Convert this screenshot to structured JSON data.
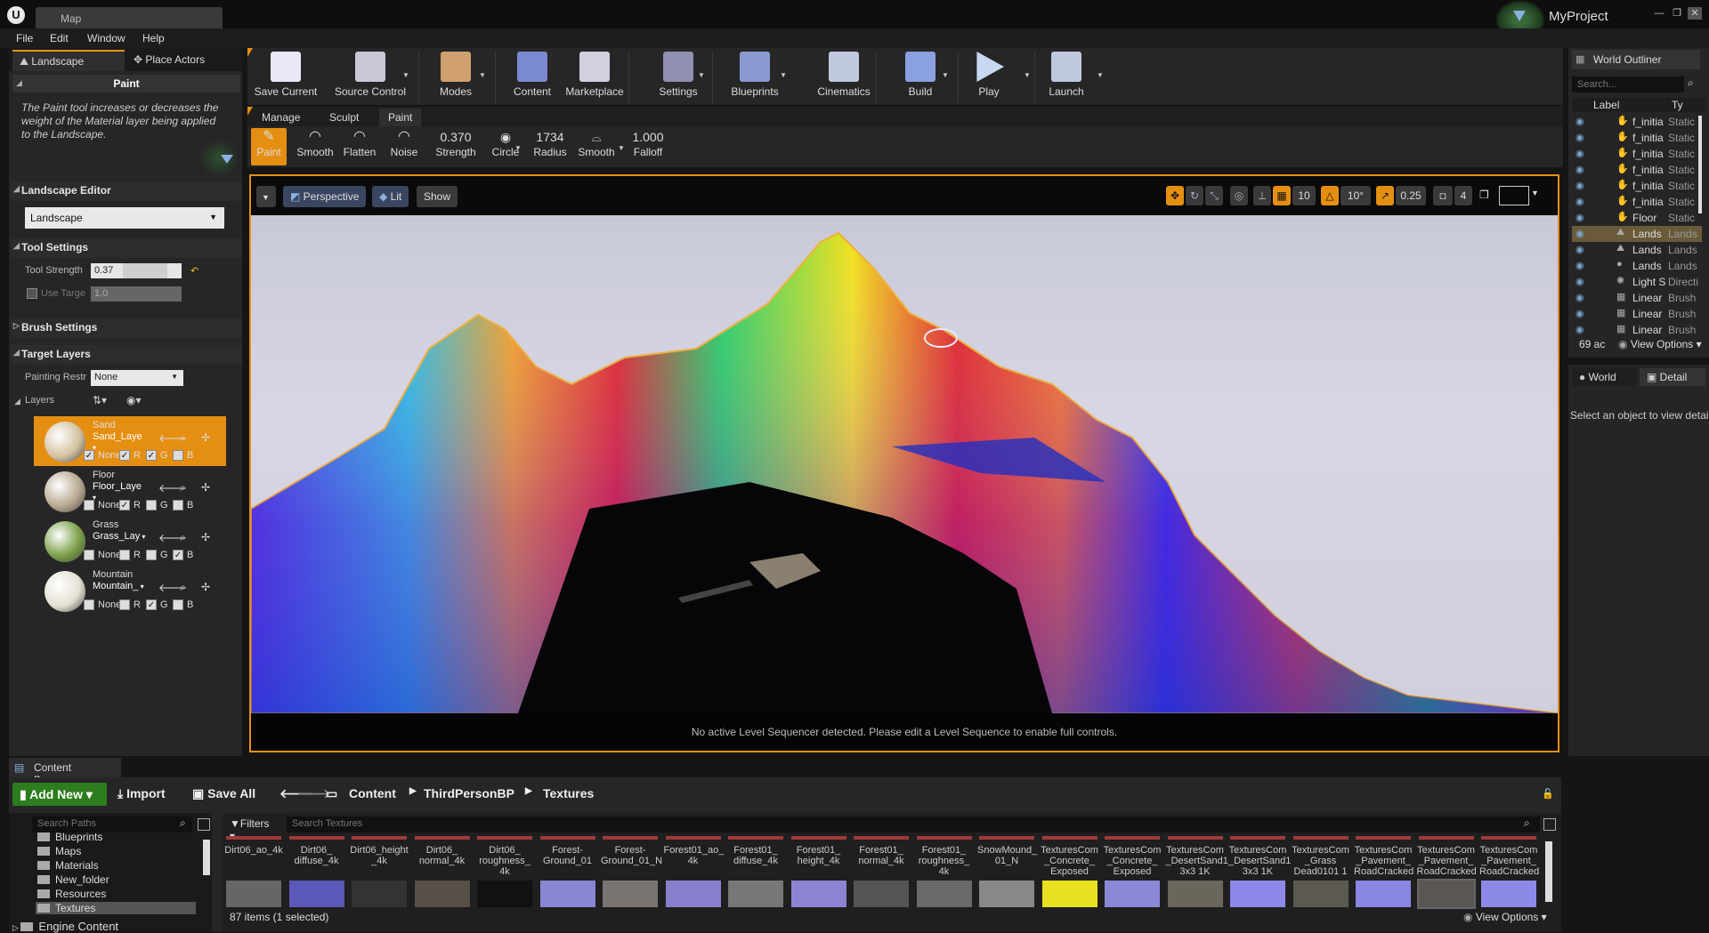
{
  "app": {
    "tab_title": "Map",
    "project": "MyProject",
    "logo": "U"
  },
  "menu": [
    "File",
    "Edit",
    "Window",
    "Help"
  ],
  "mode_tabs": [
    "Landscape",
    "Place Actors"
  ],
  "paint": {
    "header": "Paint",
    "description": "The Paint tool increases or decreases the weight of the Material layer being applied to the Landscape."
  },
  "landscape_editor": {
    "title": "Landscape Editor",
    "value": "Landscape"
  },
  "tool_settings": {
    "title": "Tool Settings",
    "strength_label": "Tool Strength",
    "strength_value": "0.37",
    "target_label": "Use Targe",
    "target_value": "1.0"
  },
  "brush_settings": {
    "title": "Brush Settings"
  },
  "target_layers": {
    "title": "Target Layers",
    "painting_label": "Painting Restr",
    "painting_value": "None",
    "layers_label": "Layers",
    "items": [
      {
        "name": "Sand",
        "asset": "Sand_Laye",
        "none": "None",
        "r": "R",
        "g": "G",
        "b": "B",
        "color": "#d4c2a0"
      },
      {
        "name": "Floor",
        "asset": "Floor_Laye",
        "none": "None",
        "r": "R",
        "g": "G",
        "b": "B",
        "color": "#b8a890"
      },
      {
        "name": "Grass",
        "asset": "Grass_Lay",
        "none": "None",
        "r": "R",
        "g": "G",
        "b": "B",
        "color": "#7aa048"
      },
      {
        "name": "Mountain",
        "asset": "Mountain_",
        "none": "None",
        "r": "R",
        "g": "G",
        "b": "B",
        "color": "#e4e0d4"
      }
    ]
  },
  "toolbar": [
    {
      "label": "Save Current",
      "icon": "save-icon"
    },
    {
      "label": "Source Control",
      "icon": "source-control-icon"
    },
    {
      "label": "Modes",
      "icon": "modes-icon"
    },
    {
      "label": "Content",
      "icon": "content-icon"
    },
    {
      "label": "Marketplace",
      "icon": "marketplace-icon"
    },
    {
      "label": "Settings",
      "icon": "settings-icon"
    },
    {
      "label": "Blueprints",
      "icon": "blueprints-icon"
    },
    {
      "label": "Cinematics",
      "icon": "cinematics-icon"
    },
    {
      "label": "Build",
      "icon": "build-icon"
    },
    {
      "label": "Play",
      "icon": "play-icon"
    },
    {
      "label": "Launch",
      "icon": "launch-icon"
    }
  ],
  "sub_tabs": [
    "Manage",
    "Sculpt",
    "Paint"
  ],
  "paint_tools": [
    {
      "label": "Paint"
    },
    {
      "label": "Smooth"
    },
    {
      "label": "Flatten"
    },
    {
      "label": "Noise"
    }
  ],
  "brush_params": [
    {
      "value": "0.370",
      "label": "Strength"
    },
    {
      "value": "",
      "label": "Circle"
    },
    {
      "value": "1734",
      "label": "Radius"
    },
    {
      "value": "",
      "label": "Smooth"
    },
    {
      "value": "1.000",
      "label": "Falloff"
    }
  ],
  "viewport": {
    "perspective": "Perspective",
    "lit": "Lit",
    "show": "Show",
    "grid": "10",
    "angle": "10°",
    "scale": "0.25",
    "speed": "4",
    "message": "No active Level Sequencer detected. Please edit a Level Sequence to enable full controls."
  },
  "outliner": {
    "tab": "World Outliner",
    "search": "Search...",
    "col_label": "Label",
    "col_type": "Ty",
    "rows": [
      {
        "name": "f_initia",
        "type": "Static"
      },
      {
        "name": "f_initia",
        "type": "Static"
      },
      {
        "name": "f_initia",
        "type": "Static"
      },
      {
        "name": "f_initia",
        "type": "Static"
      },
      {
        "name": "f_initia",
        "type": "Static"
      },
      {
        "name": "f_initia",
        "type": "Static"
      },
      {
        "name": "Floor",
        "type": "Static"
      },
      {
        "name": "Lands",
        "type": "Lands"
      },
      {
        "name": "Lands",
        "type": "Lands"
      },
      {
        "name": "Lands",
        "type": "Lands"
      },
      {
        "name": "Light S",
        "type": "Directi"
      },
      {
        "name": "Linear",
        "type": "Brush"
      },
      {
        "name": "Linear",
        "type": "Brush"
      },
      {
        "name": "Linear",
        "type": "Brush"
      }
    ],
    "count": "69 ac",
    "view_options": "View Options"
  },
  "details": {
    "world_tab": "World",
    "detail_tab": "Detail",
    "message": "Select an object to view detai"
  },
  "content_browser": {
    "tab": "Content Browser",
    "add_new": "Add New",
    "import": "Import",
    "save_all": "Save All",
    "path": [
      "Content",
      "ThirdPersonBP",
      "Textures"
    ],
    "search_paths": "Search Paths",
    "filters": "Filters",
    "search_textures": "Search Textures",
    "folders": [
      "Blueprints",
      "Maps",
      "Materials",
      "New_folder",
      "Resources",
      "Textures"
    ],
    "engine": "Engine Content",
    "assets": [
      {
        "name": "Dirt06_ao_4k",
        "color": "#666"
      },
      {
        "name": "Dirt06_ diffuse_4k",
        "color": "#5a58b8"
      },
      {
        "name": "Dirt06_height _4k",
        "color": "#333"
      },
      {
        "name": "Dirt06_ normal_4k",
        "color": "#565048"
      },
      {
        "name": "Dirt06_ roughness_ 4k",
        "color": "#111"
      },
      {
        "name": "Forest- Ground_01",
        "color": "#8a86d4"
      },
      {
        "name": "Forest- Ground_01_N",
        "color": "#7a7470"
      },
      {
        "name": "Forest01_ao_ 4k",
        "color": "#8880cc"
      },
      {
        "name": "Forest01_ diffuse_4k",
        "color": "#777"
      },
      {
        "name": "Forest01_ height_4k",
        "color": "#8c84d2"
      },
      {
        "name": "Forest01_ normal_4k",
        "color": "#555"
      },
      {
        "name": "Forest01_ roughness_ 4k",
        "color": "#6a6a6a"
      },
      {
        "name": "SnowMound_ 01_N",
        "color": "#888"
      },
      {
        "name": "TexturesCom _Concrete_ Exposed",
        "color": "#e8e020"
      },
      {
        "name": "TexturesCom _Concrete_ Exposed",
        "color": "#8c88d8"
      },
      {
        "name": "TexturesCom _DesertSand1 3x3 1K",
        "color": "#6a665c"
      },
      {
        "name": "TexturesCom _DesertSand1 3x3 1K",
        "color": "#8e88e8"
      },
      {
        "name": "TexturesCom _Grass Dead0101 1",
        "color": "#5c5a50"
      },
      {
        "name": "TexturesCom _Pavement_ RoadCracked",
        "color": "#8a86e4"
      },
      {
        "name": "TexturesCom _Pavement_ RoadCracked",
        "color": "#5a5652"
      },
      {
        "name": "TexturesCom _Pavement_ RoadCracked",
        "color": "#8c8ae6"
      }
    ],
    "status": "87 items (1 selected)",
    "view_options": "View Options"
  }
}
